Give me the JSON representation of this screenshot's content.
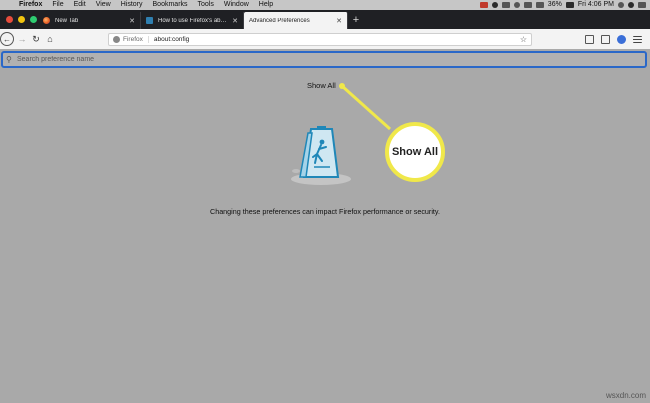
{
  "menubar": {
    "app_name": "Firefox",
    "items": [
      "File",
      "Edit",
      "View",
      "History",
      "Bookmarks",
      "Tools",
      "Window",
      "Help"
    ],
    "battery": "36%",
    "clock": "Fri 4:06 PM"
  },
  "tabs": [
    {
      "label": "New Tab",
      "favicon": "firefox-icon"
    },
    {
      "label": "How to use Firefox's about:con",
      "favicon": "site-icon"
    },
    {
      "label": "Advanced Preferences",
      "favicon": "none",
      "active": true
    }
  ],
  "navbar": {
    "identity_label": "Firefox",
    "url": "about:config"
  },
  "config": {
    "search_placeholder": "Search preference name",
    "show_all_label": "Show All",
    "warning_text": "Changing these preferences can impact Firefox performance or security."
  },
  "callout": {
    "label": "Show All",
    "ring_color": "#f0e84a"
  },
  "watermark": "wsxdn.com"
}
